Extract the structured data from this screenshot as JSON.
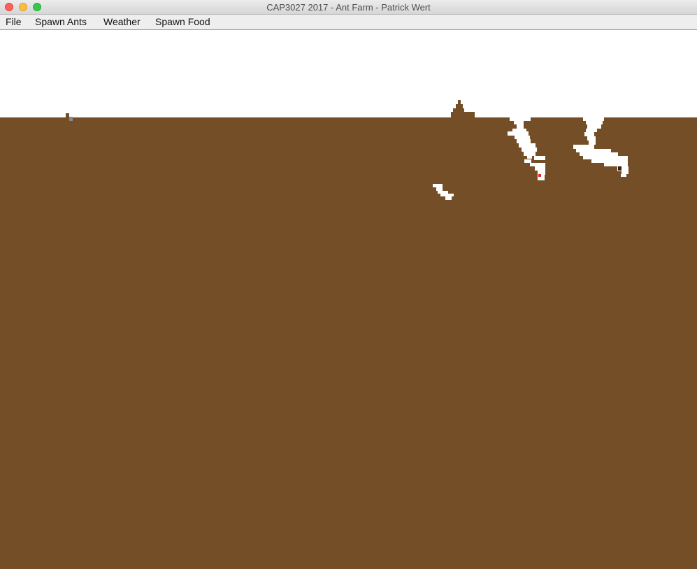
{
  "window": {
    "title": "CAP3027 2017 - Ant Farm - Patrick Wert",
    "controls": [
      "close-icon",
      "minimize-icon",
      "zoom-icon"
    ]
  },
  "menu": {
    "items": [
      {
        "label": "File"
      },
      {
        "label": "Spawn Ants"
      },
      {
        "label": "Weather"
      },
      {
        "label": "Spawn Food"
      }
    ]
  },
  "farm": {
    "colors": {
      "sky": "#ffffff",
      "soil": "#734e26",
      "tunnel": "#ffffff",
      "ant": "#e03020",
      "food": "#8a8a8a",
      "dark_ant": "#3a2410"
    }
  }
}
